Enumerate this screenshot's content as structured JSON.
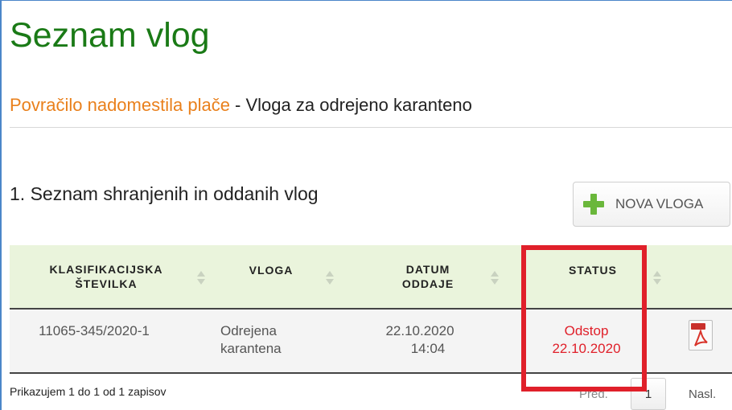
{
  "page": {
    "title": "Seznam vlog",
    "subtitle_link": "Povračilo nadomestila plače",
    "subtitle_rest": " - Vloga za odrejeno karanteno",
    "section_title": "1. Seznam shranjenih in oddanih vlog"
  },
  "toolbar": {
    "new_label": "NOVA VLOGA"
  },
  "table": {
    "headers": [
      "KLASIFIKACIJSKA ŠTEVILKA",
      "VLOGA",
      "DATUM ODDAJE",
      "STATUS"
    ],
    "rows": [
      {
        "klasifikacija": "11065-345/2020-1",
        "vloga_line1": "Odrejena",
        "vloga_line2": "karantena",
        "datum_line1": "22.10.2020",
        "datum_line2": "14:04",
        "status_line1": "Odstop",
        "status_line2": "22.10.2020"
      }
    ]
  },
  "footer": {
    "info": "Prikazujem 1 do 1 od 1 zapisov",
    "prev": "Pred.",
    "page": "1",
    "next": "Nasl."
  },
  "colors": {
    "title": "#1a7a16",
    "link": "#e9801c",
    "status": "#e0202a",
    "header_bg": "#eaf4dc",
    "highlight": "#e0202a"
  },
  "icons": [
    "plus-icon",
    "pdf-icon",
    "sort-icon"
  ]
}
